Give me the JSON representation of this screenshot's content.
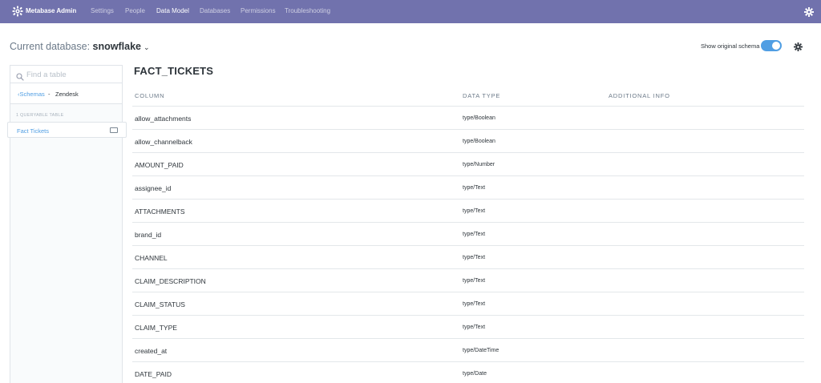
{
  "nav": {
    "brand": "Metabase Admin",
    "items": [
      {
        "label": "Settings",
        "active": false
      },
      {
        "label": "People",
        "active": false
      },
      {
        "label": "Data Model",
        "active": true
      },
      {
        "label": "Databases",
        "active": false
      },
      {
        "label": "Permissions",
        "active": false
      },
      {
        "label": "Troubleshooting",
        "active": false
      }
    ],
    "bg_color": "#7172ad"
  },
  "header": {
    "db_prefix": "Current database:",
    "db_name": "snowflake",
    "schema_toggle_label": "Show original schema",
    "schema_toggle_on": true,
    "accent_color": "#509ee3"
  },
  "sidebar": {
    "search_placeholder": "Find a table",
    "back_label": "Schemas",
    "separator": "-",
    "current_schema": "Zendesk",
    "table_count_label": "1 QUERYABLE TABLE",
    "tables": [
      {
        "label": "Fact Tickets",
        "selected": true
      }
    ]
  },
  "main": {
    "table_name": "FACT_TICKETS",
    "columns_header": {
      "column": "COLUMN",
      "data_type": "DATA TYPE",
      "additional_info": "ADDITIONAL INFO"
    },
    "fields": [
      {
        "name": "allow_attachments",
        "type": "type/Boolean"
      },
      {
        "name": "allow_channelback",
        "type": "type/Boolean"
      },
      {
        "name": "AMOUNT_PAID",
        "type": "type/Number"
      },
      {
        "name": "assignee_id",
        "type": "type/Text"
      },
      {
        "name": "ATTACHMENTS",
        "type": "type/Text"
      },
      {
        "name": "brand_id",
        "type": "type/Text"
      },
      {
        "name": "CHANNEL",
        "type": "type/Text"
      },
      {
        "name": "CLAIM_DESCRIPTION",
        "type": "type/Text"
      },
      {
        "name": "CLAIM_STATUS",
        "type": "type/Text"
      },
      {
        "name": "CLAIM_TYPE",
        "type": "type/Text"
      },
      {
        "name": "created_at",
        "type": "type/DateTime"
      },
      {
        "name": "DATE_PAID",
        "type": "type/Date"
      }
    ]
  },
  "icons": {
    "logo": "metabase-logo-icon",
    "nav_gear": "gear-icon",
    "search": "search-icon",
    "back": "chevron-left-icon",
    "caret": "chevron-down-icon",
    "hide_table": "eye-hide-icon"
  }
}
